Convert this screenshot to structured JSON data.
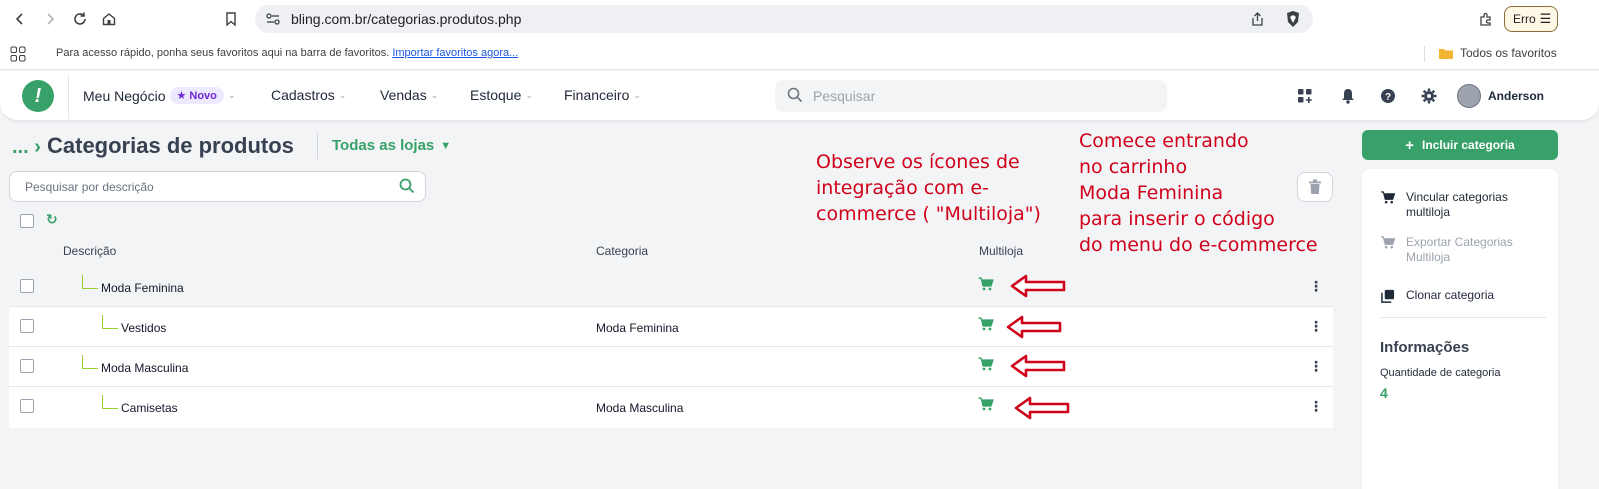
{
  "browser": {
    "url": "bling.com.br/categorias.produtos.php",
    "error_button": "Erro",
    "bookmarks_hint": "Para acesso rápido, ponha seus favoritos aqui na barra de favoritos.",
    "bookmarks_import": "Importar favoritos agora...",
    "all_bookmarks": "Todos os favoritos"
  },
  "header": {
    "menu": [
      {
        "label": "Meu Negócio",
        "badge": "Novo"
      },
      {
        "label": "Cadastros"
      },
      {
        "label": "Vendas"
      },
      {
        "label": "Estoque"
      },
      {
        "label": "Financeiro"
      }
    ],
    "search_placeholder": "Pesquisar",
    "user_name": "Anderson"
  },
  "page": {
    "breadcrumb": "...",
    "title": "Categorias de produtos",
    "store_filter": "Todas as lojas",
    "search_placeholder": "Pesquisar por descrição"
  },
  "table": {
    "columns": {
      "description": "Descrição",
      "category": "Categoria",
      "multistore": "Multiloja"
    },
    "rows": [
      {
        "name": "Moda Feminina",
        "category": "",
        "level": 1
      },
      {
        "name": "Vestidos",
        "category": "Moda Feminina",
        "level": 2
      },
      {
        "name": "Moda Masculina",
        "category": "",
        "level": 1
      },
      {
        "name": "Camisetas",
        "category": "Moda Masculina",
        "level": 2
      }
    ]
  },
  "annotations": {
    "left": [
      "Observe os ícones de",
      "integração com e-",
      "commerce ( \"Multiloja\")"
    ],
    "right": [
      "Comece entrando",
      "no carrinho",
      "Moda Feminina",
      "para inserir o código",
      "do menu do e-commerce"
    ]
  },
  "sidebar": {
    "add_button": "Incluir categoria",
    "actions": [
      {
        "label": "Vincular categorias multiloja",
        "enabled": true
      },
      {
        "label": "Exportar Categorias Multiloja",
        "enabled": false
      },
      {
        "label": "Clonar categoria",
        "enabled": true
      }
    ],
    "info_title": "Informações",
    "info_label": "Quantidade de categoria",
    "info_value": "4"
  },
  "colors": {
    "brand_green": "#38a169",
    "annotation_red": "#d0021b"
  }
}
